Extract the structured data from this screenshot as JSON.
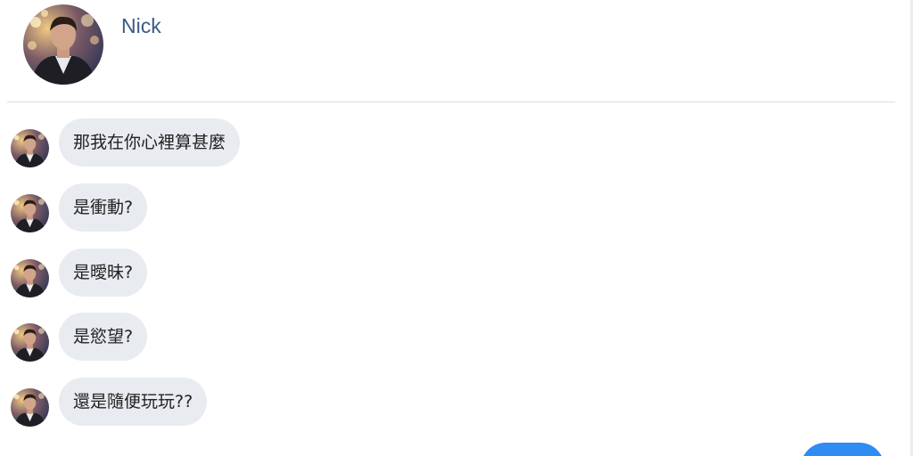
{
  "contact": {
    "name": "Nick",
    "avatar_icon": "profile-photo-icon"
  },
  "messages": [
    {
      "text": "那我在你心裡算甚麼",
      "sender": "Nick"
    },
    {
      "text": "是衝動?",
      "sender": "Nick"
    },
    {
      "text": "是曖昧?",
      "sender": "Nick"
    },
    {
      "text": "是慾望?",
      "sender": "Nick"
    },
    {
      "text": "還是隨便玩玩??",
      "sender": "Nick"
    }
  ],
  "colors": {
    "name_color": "#3b5a86",
    "received_bubble": "#e8ebef",
    "sent_bubble": "#2e8cf3"
  }
}
